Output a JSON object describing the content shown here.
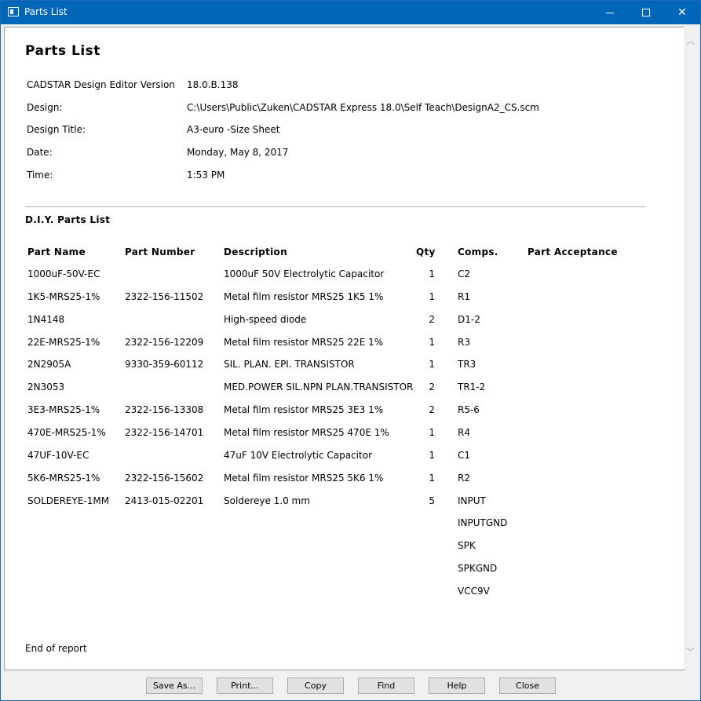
{
  "window": {
    "title": "Parts List"
  },
  "report": {
    "title": "Parts List",
    "meta": [
      {
        "label": "CADSTAR Design Editor Version",
        "value": "18.0.B.138"
      },
      {
        "label": "Design:",
        "value": "C:\\Users\\Public\\Zuken\\CADSTAR Express 18.0\\Self Teach\\DesignA2_CS.scm"
      },
      {
        "label": "Design Title:",
        "value": "A3-euro -Size Sheet"
      },
      {
        "label": "Date:",
        "value": "Monday, May 8, 2017"
      },
      {
        "label": "Time:",
        "value": "1:53 PM"
      }
    ],
    "section_title": "D.I.Y. Parts List",
    "columns": [
      "Part Name",
      "Part Number",
      "Description",
      "Qty",
      "Comps.",
      "Part Acceptance"
    ],
    "rows": [
      [
        "1000uF-50V-EC",
        "",
        "1000uF 50V Electrolytic Capacitor",
        "1",
        "C2"
      ],
      [
        "1K5-MRS25-1%",
        "2322-156-11502",
        "Metal film resistor MRS25 1K5 1%",
        "1",
        "R1"
      ],
      [
        "1N4148",
        "",
        "High-speed diode",
        "2",
        "D1-2"
      ],
      [
        "22E-MRS25-1%",
        "2322-156-12209",
        "Metal film resistor MRS25 22E 1%",
        "1",
        "R3"
      ],
      [
        "2N2905A",
        "9330-359-60112",
        "SIL. PLAN. EPI. TRANSISTOR",
        "1",
        "TR3"
      ],
      [
        "2N3053",
        "",
        "MED.POWER SIL.NPN PLAN.TRANSISTOR",
        "2",
        "TR1-2"
      ],
      [
        "3E3-MRS25-1%",
        "2322-156-13308",
        "Metal film resistor MRS25 3E3 1%",
        "2",
        "R5-6"
      ],
      [
        "470E-MRS25-1%",
        "2322-156-14701",
        "Metal film resistor MRS25 470E 1%",
        "1",
        "R4"
      ],
      [
        "47UF-10V-EC",
        "",
        "47uF 10V Electrolytic Capacitor",
        "1",
        "C1"
      ],
      [
        "5K6-MRS25-1%",
        "2322-156-15602",
        "Metal film resistor MRS25 5K6 1%",
        "1",
        "R2"
      ],
      [
        "SOLDEREYE-1MM",
        "2413-015-02201",
        "Soldereye 1.0 mm",
        "5",
        "INPUT"
      ],
      [
        "",
        "",
        "",
        "",
        "INPUTGND"
      ],
      [
        "",
        "",
        "",
        "",
        "SPK"
      ],
      [
        "",
        "",
        "",
        "",
        "SPKGND"
      ],
      [
        "",
        "",
        "",
        "",
        "VCC9V"
      ]
    ],
    "end_text": "End of report"
  },
  "buttons": {
    "save_as": "Save As...",
    "print": "Print...",
    "copy": "Copy",
    "find": "Find",
    "help": "Help",
    "close": "Close"
  }
}
